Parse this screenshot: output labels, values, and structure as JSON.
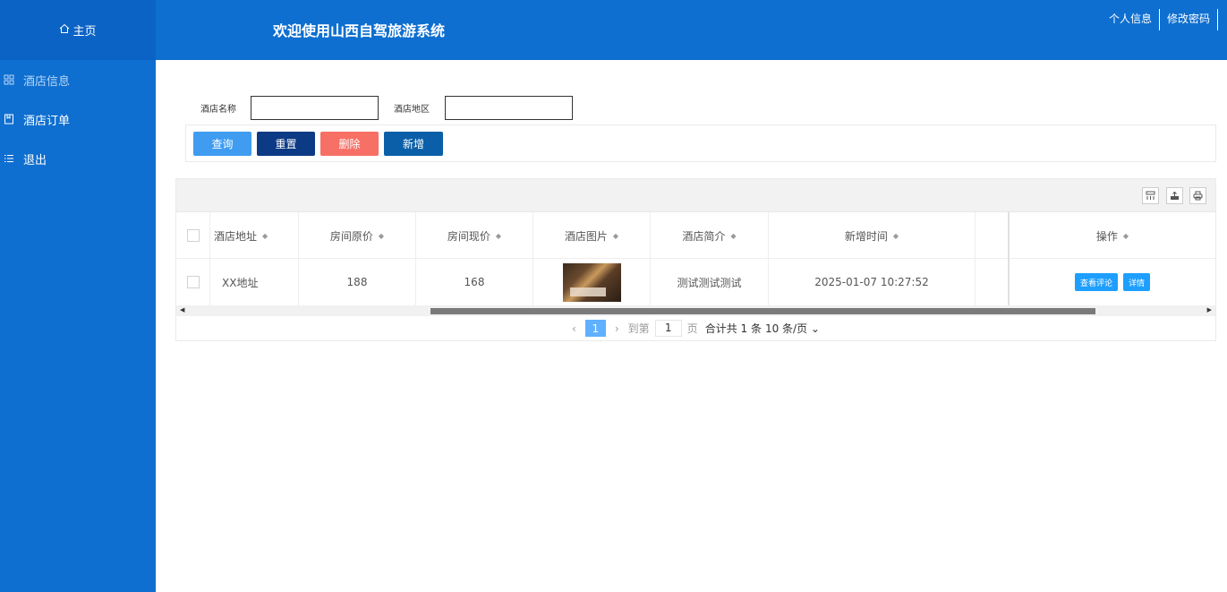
{
  "sidebar": {
    "home_label": "主页",
    "items": [
      {
        "label": "酒店信息",
        "icon": "grid-icon"
      },
      {
        "label": "酒店订单",
        "icon": "book-icon"
      },
      {
        "label": "退出",
        "icon": "list-icon"
      }
    ]
  },
  "header": {
    "title": "欢迎使用山西自驾旅游系统",
    "links": [
      "个人信息",
      "修改密码"
    ]
  },
  "search": {
    "name_label": "酒店名称",
    "name_value": "",
    "area_label": "酒店地区",
    "area_value": ""
  },
  "buttons": {
    "query": "查询",
    "reset": "重置",
    "delete": "删除",
    "add": "新增"
  },
  "table": {
    "columns": [
      "酒店地址",
      "房间原价",
      "房间现价",
      "酒店图片",
      "酒店简介",
      "新增时间",
      "操作"
    ],
    "rows": [
      {
        "address": "XX地址",
        "orig_price": "188",
        "cur_price": "168",
        "intro": "测试测试测试",
        "time": "2025-01-07 10:27:52"
      }
    ],
    "row_actions": [
      "查看评论",
      "详情"
    ]
  },
  "pager": {
    "current": "1",
    "goto_prefix": "到第",
    "goto_value": "1",
    "goto_suffix": "页",
    "total": "合计共 1 条",
    "page_size": "10 条/页"
  },
  "colors": {
    "brand": "#0e6fd0",
    "query_btn": "#3f9cf0",
    "reset_btn": "#0c3a84",
    "delete_btn": "#f77066",
    "add_btn": "#0a5fa8",
    "action_btn": "#1e9fff"
  }
}
